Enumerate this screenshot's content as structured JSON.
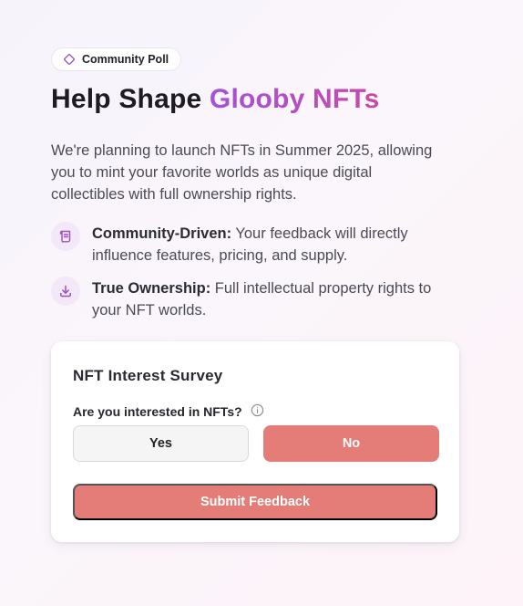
{
  "badge": {
    "icon": "diamond-icon",
    "label": "Community Poll"
  },
  "heading": {
    "prefix": "Help Shape",
    "highlight": "Glooby NFTs"
  },
  "description": "We're planning to launch NFTs in Summer 2025, allowing you to mint your favorite worlds as unique digital collectibles with full ownership rights.",
  "features": [
    {
      "icon": "scroll-icon",
      "title": "Community-Driven:",
      "text": "Your feedback will directly influence features, pricing, and supply."
    },
    {
      "icon": "download-icon",
      "title": "True Ownership:",
      "text": "Full intellectual property rights to your NFT worlds."
    }
  ],
  "survey": {
    "title": "NFT Interest Survey",
    "question": "Are you interested in NFTs?",
    "info_icon": "info-icon",
    "options": [
      {
        "label": "Yes",
        "selected": false
      },
      {
        "label": "No",
        "selected": true
      }
    ],
    "submit_label": "Submit Feedback"
  },
  "colors": {
    "accent": "#e47c78",
    "gradient_start": "#a451d9",
    "gradient_end": "#c74aa8",
    "icon_bg": "#f2e8f7",
    "icon_stroke": "#a04fc0"
  }
}
